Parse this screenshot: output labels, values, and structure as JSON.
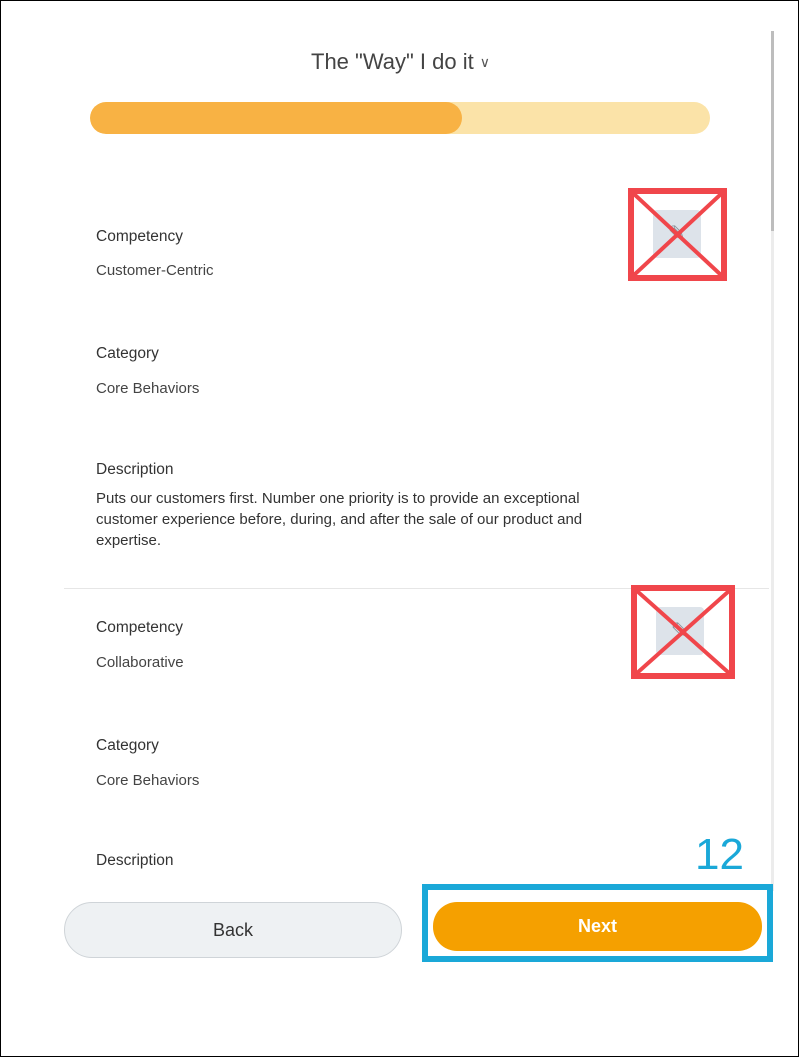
{
  "header": {
    "title": "The \"Way\" I do it",
    "chevron_icon": "chevron-down-icon",
    "progress_percent": 60
  },
  "items": [
    {
      "competency_label": "Competency",
      "competency_value": "Customer-Centric",
      "category_label": "Category",
      "category_value": "Core Behaviors",
      "description_label": "Description",
      "description_value": "Puts our customers first. Number one priority is to provide an exceptional customer experience before, during, and after the sale of our product and expertise.",
      "edit_icon": "pencil-icon"
    },
    {
      "competency_label": "Competency",
      "competency_value": "Collaborative",
      "category_label": "Category",
      "category_value": "Core Behaviors",
      "description_label": "Description",
      "edit_icon": "pencil-icon"
    }
  ],
  "footer": {
    "back_label": "Back",
    "next_label": "Next",
    "step_number": "12"
  },
  "colors": {
    "progress_fill": "#f8b244",
    "progress_track": "#fbe3a8",
    "next_button": "#f5a000",
    "annotation_red": "#f0464b",
    "annotation_blue": "#1aa8d8"
  }
}
